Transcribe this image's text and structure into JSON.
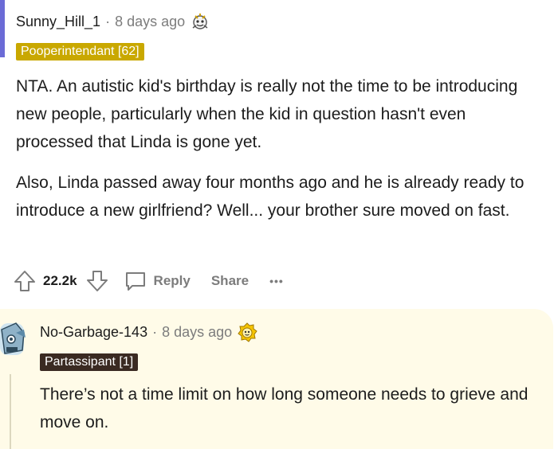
{
  "comment1": {
    "author": "Sunny_Hill_1",
    "time": "8 days ago",
    "flair": "Pooperintendant [62]",
    "paragraphs": [
      "NTA. An autistic kid's birthday is really not the time to be introducing new people, particularly when the kid in question hasn't even processed that Linda is gone yet.",
      "Also, Linda passed away four months ago and he is already ready to introduce a new girlfriend? Well... your brother sure moved on fast."
    ],
    "votes": "22.2k",
    "reply_label": "Reply",
    "share_label": "Share",
    "more_label": "•••"
  },
  "comment2": {
    "author": "No-Garbage-143",
    "time": "8 days ago",
    "flair": "Partassipant [1]",
    "paragraphs": [
      "There’s not a time limit on how long someone needs to grieve and move on."
    ]
  },
  "colors": {
    "flair_gold": "#c9a800",
    "flair_dark": "#3a2a22",
    "muted": "#7c7c7c",
    "reply_bg": "#fffbe8"
  }
}
